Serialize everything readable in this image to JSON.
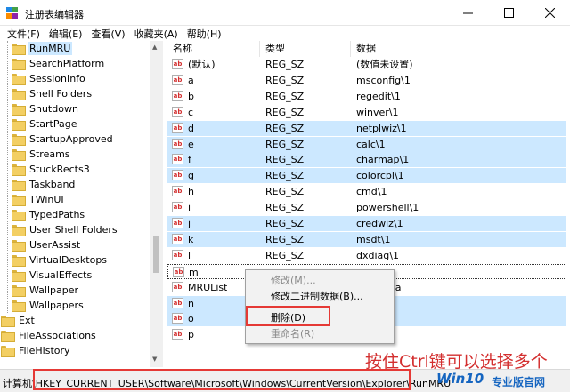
{
  "window": {
    "title": "注册表编辑器"
  },
  "menu": [
    "文件(F)",
    "编辑(E)",
    "查看(V)",
    "收藏夹(A)",
    "帮助(H)"
  ],
  "tree": {
    "items": [
      "RunMRU",
      "SearchPlatform",
      "SessionInfo",
      "Shell Folders",
      "Shutdown",
      "StartPage",
      "StartupApproved",
      "Streams",
      "StuckRects3",
      "Taskband",
      "TWinUI",
      "TypedPaths",
      "User Shell Folders",
      "UserAssist",
      "VirtualDesktops",
      "VisualEffects",
      "Wallpaper",
      "Wallpapers"
    ],
    "root_items": [
      "Ext",
      "FileAssociations",
      "FileHistory"
    ],
    "selected": "RunMRU"
  },
  "columns": {
    "name": "名称",
    "type": "类型",
    "data": "数据"
  },
  "rows": [
    {
      "name": "(默认)",
      "type": "REG_SZ",
      "data": "(数值未设置)",
      "selected": false
    },
    {
      "name": "a",
      "type": "REG_SZ",
      "data": "msconfig\\1",
      "selected": false
    },
    {
      "name": "b",
      "type": "REG_SZ",
      "data": "regedit\\1",
      "selected": false
    },
    {
      "name": "c",
      "type": "REG_SZ",
      "data": "winver\\1",
      "selected": false
    },
    {
      "name": "d",
      "type": "REG_SZ",
      "data": "netplwiz\\1",
      "selected": true
    },
    {
      "name": "e",
      "type": "REG_SZ",
      "data": "calc\\1",
      "selected": true
    },
    {
      "name": "f",
      "type": "REG_SZ",
      "data": "charmap\\1",
      "selected": true
    },
    {
      "name": "g",
      "type": "REG_SZ",
      "data": "colorcpl\\1",
      "selected": true
    },
    {
      "name": "h",
      "type": "REG_SZ",
      "data": "cmd\\1",
      "selected": false
    },
    {
      "name": "i",
      "type": "REG_SZ",
      "data": "powershell\\1",
      "selected": false
    },
    {
      "name": "j",
      "type": "REG_SZ",
      "data": "credwiz\\1",
      "selected": true
    },
    {
      "name": "k",
      "type": "REG_SZ",
      "data": "msdt\\1",
      "selected": true
    },
    {
      "name": "l",
      "type": "REG_SZ",
      "data": "dxdiag\\1",
      "selected": false
    },
    {
      "name": "m",
      "type": "",
      "data": "",
      "selected": false,
      "focus": true
    },
    {
      "name": "MRUList",
      "type": "",
      "data": "jihgfedca",
      "selected": false
    },
    {
      "name": "n",
      "type": "",
      "data": "",
      "selected": true
    },
    {
      "name": "o",
      "type": "",
      "data": "",
      "selected": true
    },
    {
      "name": "p",
      "type": "",
      "data": "",
      "selected": false
    }
  ],
  "context_menu": {
    "modify": "修改(M)...",
    "modify_binary": "修改二进制数据(B)...",
    "delete": "删除(D)",
    "rename": "重命名(R)"
  },
  "hint": "按住Ctrl键可以选择多个",
  "status": {
    "path": "计算机\\HKEY_CURRENT_USER\\Software\\Microsoft\\Windows\\CurrentVersion\\Explorer\\RunMRU"
  },
  "watermark": {
    "brand": "Win10",
    "sub": "专业版官网"
  },
  "colors": {
    "selection": "#cce8ff",
    "annotation": "#e53935",
    "brand": "#1565c0"
  }
}
